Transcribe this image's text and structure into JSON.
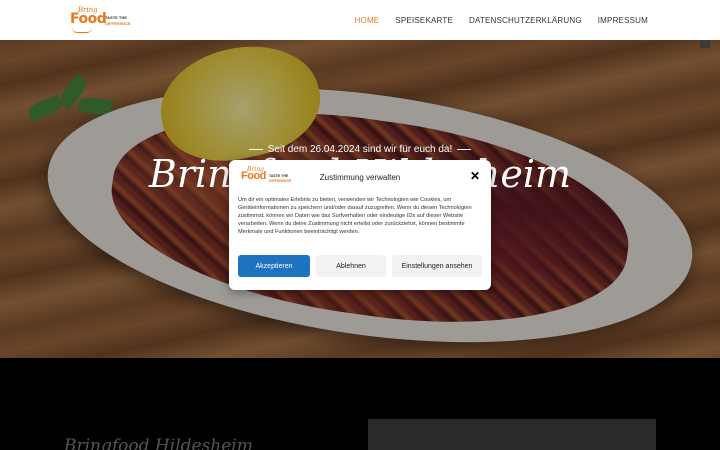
{
  "brand": {
    "logo_word_small": "Bring",
    "logo_word_main": "Food",
    "tagline_line1": "TASTE THE",
    "tagline_line2": "DIFFERENCE",
    "accent_color": "#e8791e"
  },
  "nav": {
    "items": [
      {
        "label": "HOME",
        "active": true
      },
      {
        "label": "SPEISEKARTE",
        "active": false
      },
      {
        "label": "DATENSCHUTZERKLÄRUNG",
        "active": false
      },
      {
        "label": "IMPRESSUM",
        "active": false
      }
    ]
  },
  "hero": {
    "subtitle": "Seit dem 26.04.2024 sind wir für euch da!",
    "title": "Bringfood Hildesheim"
  },
  "section": {
    "title": "Bringfood Hildesheim"
  },
  "consent": {
    "title": "Zustimmung verwalten",
    "body": "Um dir ein optimales Erlebnis zu bieten, verwenden wir Technologien wie Cookies, um Geräteinformationen zu speichern und/oder darauf zuzugreifen. Wenn du diesen Technologien zustimmst, können wir Daten wie das Surfverhalten oder eindeutige IDs auf dieser Website verarbeiten. Wenn du deine Zustimmung nicht erteilst oder zurückziehst, können bestimmte Merkmale und Funktionen beeinträchtigt werden.",
    "accept_label": "Akzeptieren",
    "deny_label": "Ablehnen",
    "settings_label": "Einstellungen ansehen",
    "close_icon": "close-icon",
    "primary_color": "#1e73be"
  }
}
